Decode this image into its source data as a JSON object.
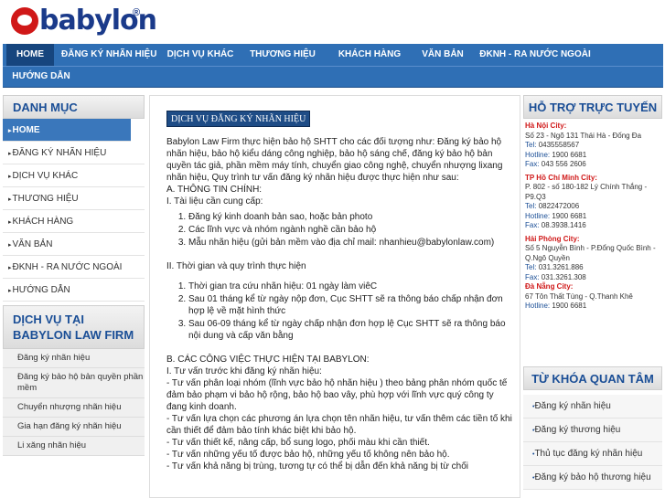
{
  "brand": {
    "name": "babylon",
    "registered": "®",
    "logo_color": "#d01818",
    "text_color": "#1a3a8a"
  },
  "nav": {
    "row1": [
      "HOME",
      "ĐĂNG KÝ NHÃN HIỆU",
      "DỊCH VỤ KHÁC",
      "THƯƠNG HIỆU",
      "KHÁCH HÀNG",
      "VĂN BẢN",
      "ĐKNH - RA NƯỚC NGOÀI"
    ],
    "row2": [
      "HƯỚNG DẪN"
    ],
    "active": "HOME",
    "bg_color": "#2f6fb5"
  },
  "left": {
    "menu_title": "DANH MỤC",
    "menu": [
      "HOME",
      "ĐĂNG KÝ NHÃN HIỆU",
      "DỊCH VỤ KHÁC",
      "THƯƠNG HIỆU",
      "KHÁCH HÀNG",
      "VĂN BẢN",
      "ĐKNH - RA NƯỚC NGOÀI",
      "HƯỚNG DẪN"
    ],
    "services_title": "DỊCH VỤ TẠI BABYLON LAW FIRM",
    "services": [
      "Đăng ký nhãn hiệu",
      "Đăng ký bảo hộ bản quyền phần mềm",
      "Chuyển nhượng nhãn hiệu",
      "Gia hạn đăng ký nhãn hiệu",
      "Li xăng nhãn hiệu"
    ]
  },
  "main": {
    "heading": "DỊCH VỤ ĐĂNG KÝ NHÃN HIỆU",
    "intro": "Babylon Law Firm thực hiện bảo hộ SHTT cho các đối tượng như: Đăng ký bảo hộ nhãn hiệu, bảo hộ kiểu dáng công nghiệp, bảo hộ sáng chế, đăng ký bảo hộ bản quyền tác giả, phần mềm máy tính, chuyển giao công nghệ, chuyển nhượng lixang nhãn hiệu, Quy trình tư vấn đăng ký nhãn hiệu được thực hiện như sau:",
    "section_a": "A. THÔNG TIN CHÍNH:",
    "sub_1": "I. Tài liệu cần cung cấp:",
    "docs": [
      "Đăng ký kinh doanh bản sao, hoặc bản photo",
      "Các lĩnh vực và nhóm ngành nghề cần bảo hộ",
      "Mẫu nhãn hiệu (gửi bản mềm vào địa chỉ mail: nhanhieu@babylonlaw.com)"
    ],
    "sub_2": "II. Thời gian và quy trình thực hiện",
    "timeline": [
      "Thời gian tra cứu nhãn hiệu: 01 ngày làm viêC",
      "Sau 01 tháng kể từ ngày nộp đơn, Cục SHTT sẽ ra thông báo chấp nhận đơn hợp lệ về mặt hình thức",
      "Sau 06-09 tháng kể từ ngày chấp nhận đơn hợp lệ Cục SHTT sẽ ra thông báo nội dung và cấp văn bằng"
    ],
    "section_b": "B. CÁC CÔNG VIỆC THỰC HIỆN TẠI BABYLON:",
    "sub_b1": "I. Tư vấn trước khi đăng ký nhãn hiệu:",
    "consult": [
      "- Tư vấn phân loại nhóm (lĩnh vực bảo hộ nhãn hiệu ) theo bảng phân nhóm quốc tế đảm bảo phạm vi bảo hộ rộng, bảo hộ bao vây, phù hợp với lĩnh vực quý công ty đang kinh doanh.",
      "- Tư vấn lựa chọn các phương án lựa chọn tên nhãn hiệu, tư vấn thêm các tiền tố khi cần thiết để đảm bảo tính khác biệt khi bảo hộ.",
      "- Tư vấn thiết kế, nâng cấp, bổ sung logo, phối màu khi cần thiết.",
      "- Tư vấn những yếu tố được bảo hộ, những yếu tố không nên bảo hộ.",
      "- Tư vấn khả năng bị trùng, tương tự có thể bị dẫn đến khả năng bị từ chối"
    ]
  },
  "right": {
    "support_title": "HỖ TRỢ TRỰC TUYẾN",
    "offices": [
      {
        "city": "Hà Nội City:",
        "address": "Số 23 - Ngõ 131 Thái Hà - Đống Đa",
        "tel_label": "Tel:",
        "tel": "0435558567",
        "hot_label": "Hotline:",
        "hot": "1900 6681",
        "fax_label": "Fax:",
        "fax": "043 556 2606"
      },
      {
        "city": "TP Hồ Chí Minh City:",
        "address": "P. 802 - số 180-182 Lý Chính Thắng - P9.Q3",
        "tel_label": "Tel:",
        "tel": "0822472006",
        "hot_label": "Hotline:",
        "hot": "1900 6681",
        "fax_label": "Fax:",
        "fax": "08.3938.1416"
      },
      {
        "city": "Hải Phòng City:",
        "address": "Số 5 Nguyễn Bình - P.Đổng Quốc Bình - Q.Ngô Quyền",
        "tel_label": "Tel:",
        "tel": "031.3261.886",
        "hot_label": "",
        "hot": "",
        "fax_label": "Fax:",
        "fax": "031.3261.308"
      },
      {
        "city": "Đà Nẵng City:",
        "address": "67 Tôn Thất Tùng - Q.Thanh Khê",
        "tel_label": "",
        "tel": "",
        "hot_label": "Hotline:",
        "hot": "1900 6681",
        "fax_label": "",
        "fax": ""
      }
    ],
    "keyword_title": "TỪ KHÓA QUAN TÂM",
    "keywords": [
      "Đăng ký nhãn hiệu",
      "Đăng ký thương hiệu",
      "Thủ tục đăng ký nhãn hiệu",
      "Đăng ký bảo hộ thương hiệu"
    ]
  }
}
